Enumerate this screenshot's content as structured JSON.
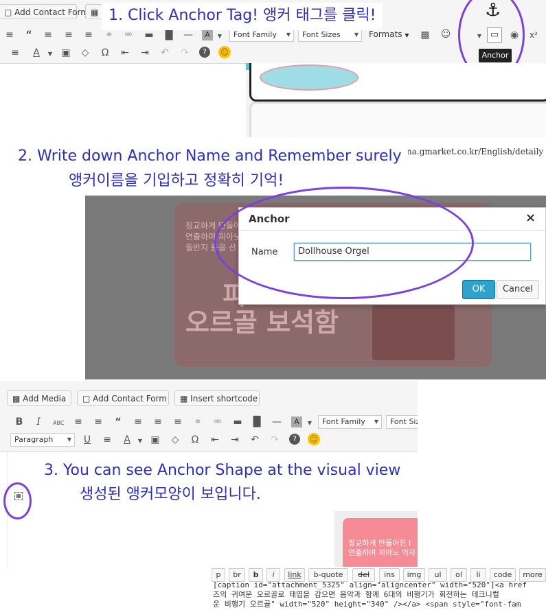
{
  "top_toolbar": {
    "add_contact_form": "Add Contact Form",
    "font_family": "Font Family",
    "font_sizes": "Font Sizes",
    "formats": "Formats",
    "anchor_tooltip": "Anchor"
  },
  "steps": {
    "step1": "1. Click Anchor Tag! 앵커 태그를 클릭!",
    "step2_line1": "2. Write down Anchor Name and Remember surely",
    "step2_line2": "앵커이름을 기입하고 정확히 기억!",
    "step3_line1": "3. You can see Anchor Shape at the visual view",
    "step3_line2": "생성된 앵커모양이 보입니다."
  },
  "background_url": "na.gmarket.co.kr/English/detaily",
  "dialog": {
    "title": "Anchor",
    "close": "×",
    "name_label": "Name",
    "name_value": "Dollhouse Orgel",
    "ok": "OK",
    "cancel": "Cancel"
  },
  "product_text": {
    "line1": "정교하게 만들어진",
    "line2": "연출하며 피아노",
    "line3": "돌반지 등을 선",
    "big1": "피",
    "big2": "오르골 보석함"
  },
  "bottom_editor": {
    "add_media": "Add Media",
    "add_contact_form": "Add Contact Form",
    "insert_shortcode": "Insert shortcode",
    "font_family": "Font Family",
    "font_size": "Font Siz",
    "paragraph": "Paragraph"
  },
  "thumb_text": {
    "line1": "정교하게 만들어진 I",
    "line2": "연출하며 피아노 의자"
  },
  "quicktags": [
    "p",
    "br",
    "b",
    "i",
    "link",
    "b-quote",
    "del",
    "ins",
    "img",
    "ul",
    "ol",
    "li",
    "code",
    "more"
  ],
  "code_lines": [
    "[caption id=\"attachment_5325\" align=\"aligncenter\" width=\"520\"]<a href",
    "즈의 귀여운 오르골로 태엽을 감으면 음악과 함께 6대의 비행기가 회전하는 테크니컬",
    "운 비행기 오르골\" width=\"520\" height=\"340\" /></a> <span style=\"font-fam"
  ],
  "colors": {
    "accent_blue": "#2c2cc8",
    "highlight_circle": "#7b3fe4",
    "ok_button": "#2ea2cc"
  }
}
